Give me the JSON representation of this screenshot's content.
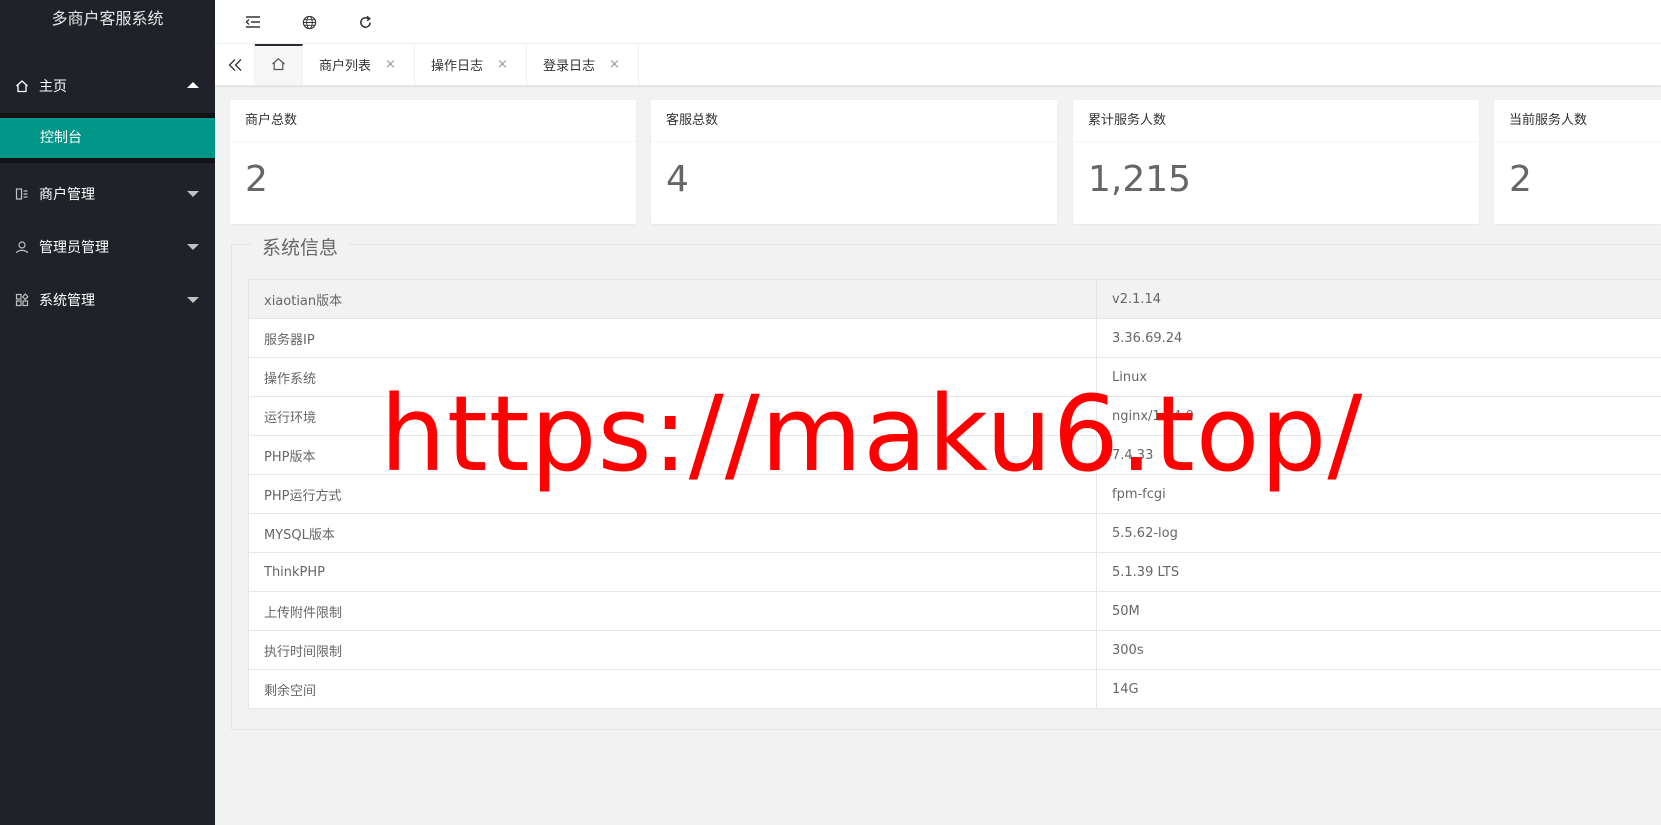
{
  "sidebar": {
    "title": "多商户客服系统",
    "home": {
      "label": "主页",
      "icon": "home-icon"
    },
    "home_sub": {
      "label": "控制台"
    },
    "groups": [
      {
        "label": "商户管理",
        "icon": "merchant-icon"
      },
      {
        "label": "管理员管理",
        "icon": "user-icon"
      },
      {
        "label": "系统管理",
        "icon": "apps-icon"
      }
    ]
  },
  "header": {
    "icons": [
      "menu-fold-icon",
      "globe-icon",
      "refresh-icon"
    ]
  },
  "tabs": [
    {
      "label": "商户列表",
      "close": "×"
    },
    {
      "label": "操作日志",
      "close": "×"
    },
    {
      "label": "登录日志",
      "close": "×"
    }
  ],
  "stats": [
    {
      "title": "商户总数",
      "value": "2"
    },
    {
      "title": "客服总数",
      "value": "4"
    },
    {
      "title": "累计服务人数",
      "value": "1,215"
    },
    {
      "title": "当前服务人数",
      "value": "2"
    }
  ],
  "system_info": {
    "legend": "系统信息",
    "rows": [
      {
        "key": "xiaotian版本",
        "value": "v2.1.14"
      },
      {
        "key": "服务器IP",
        "value": "3.36.69.24"
      },
      {
        "key": "操作系统",
        "value": "Linux"
      },
      {
        "key": "运行环境",
        "value": "nginx/1.24.0"
      },
      {
        "key": "PHP版本",
        "value": "7.4.33"
      },
      {
        "key": "PHP运行方式",
        "value": "fpm-fcgi"
      },
      {
        "key": "MYSQL版本",
        "value": "5.5.62-log"
      },
      {
        "key": "ThinkPHP",
        "value": "5.1.39 LTS"
      },
      {
        "key": "上传附件限制",
        "value": "50M"
      },
      {
        "key": "执行时间限制",
        "value": "300s"
      },
      {
        "key": "剩余空间",
        "value": "14G"
      }
    ]
  },
  "watermark": "https://maku6.top/",
  "colors": {
    "sidebar_bg": "#20222a",
    "active_bg": "#009688",
    "watermark": "#ff0000"
  }
}
